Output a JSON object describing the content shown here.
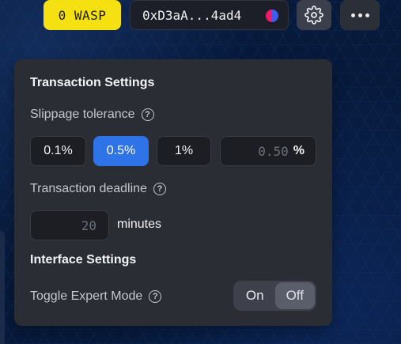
{
  "header": {
    "token_badge": "0 WASP",
    "address": "0xD3aA...4ad4",
    "settings_icon": "gear-icon",
    "more_icon": "ellipsis-icon"
  },
  "transaction_settings": {
    "title": "Transaction Settings",
    "slippage_label": "Slippage tolerance",
    "slippage_options": [
      "0.1%",
      "0.5%",
      "1%"
    ],
    "slippage_selected": "0.5%",
    "custom_slippage_placeholder": "0.50",
    "percent_symbol": "%",
    "deadline_label": "Transaction deadline",
    "deadline_placeholder": "20",
    "deadline_unit": "minutes"
  },
  "interface_settings": {
    "title": "Interface Settings",
    "expert_mode_label": "Toggle Expert Mode",
    "expert_mode_on": "On",
    "expert_mode_off": "Off",
    "expert_mode_state": "Off"
  },
  "colors": {
    "accent": "#2f73e8",
    "badge": "#f5e012",
    "panel": "#2b2d34"
  }
}
